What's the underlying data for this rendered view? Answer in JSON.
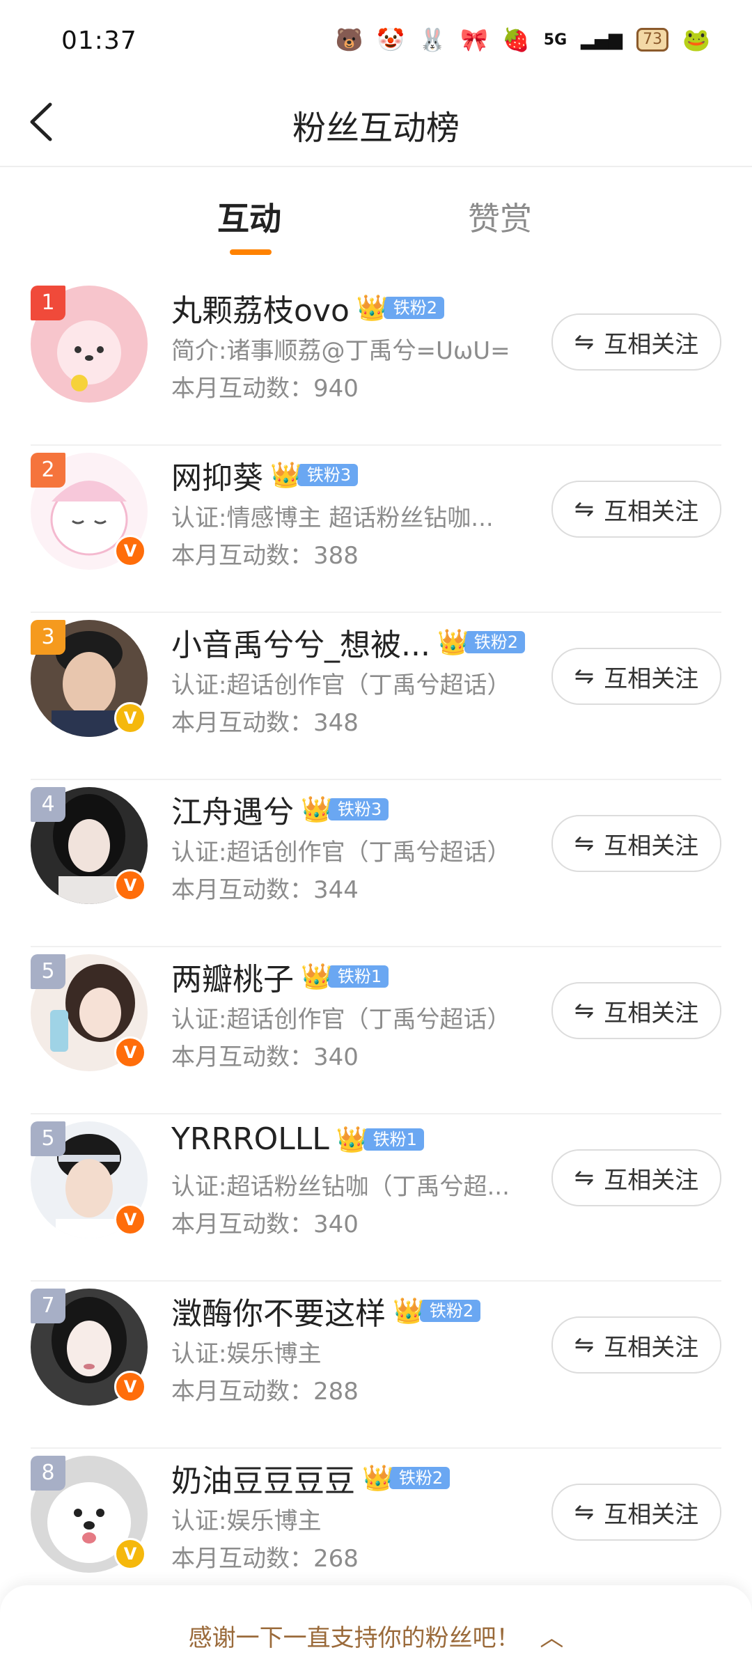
{
  "status_bar": {
    "time": "01:37",
    "network": "5G",
    "battery": "73"
  },
  "header": {
    "title": "粉丝互动榜"
  },
  "tabs": [
    {
      "label": "互动",
      "active": true
    },
    {
      "label": "赞赏",
      "active": false
    }
  ],
  "follow_label": "互相关注",
  "rows": [
    {
      "rank": "1",
      "name": "丸颗荔枝ovo",
      "fan_level": "铁粉2",
      "desc": "简介:诸事顺荔@丁禹兮=ᑌωᑌ=",
      "count": "本月互动数：940"
    },
    {
      "rank": "2",
      "name": "网抑葵",
      "fan_level": "铁粉3",
      "desc": "认证:情感博主 超话粉丝钻咖...",
      "count": "本月互动数：388"
    },
    {
      "rank": "3",
      "name": "小音禹兮兮_想被...",
      "fan_level": "铁粉2",
      "desc": "认证:超话创作官（丁禹兮超话）",
      "count": "本月互动数：348"
    },
    {
      "rank": "4",
      "name": "江舟遇兮",
      "fan_level": "铁粉3",
      "desc": "认证:超话创作官（丁禹兮超话）",
      "count": "本月互动数：344"
    },
    {
      "rank": "5",
      "name": "两瓣桃子",
      "fan_level": "铁粉1",
      "desc": "认证:超话创作官（丁禹兮超话）",
      "count": "本月互动数：340"
    },
    {
      "rank": "5",
      "name": "YRRROLLL",
      "fan_level": "铁粉1",
      "desc": "认证:超话粉丝钻咖（丁禹兮超...",
      "count": "本月互动数：340"
    },
    {
      "rank": "7",
      "name": "澂酶你不要这样",
      "fan_level": "铁粉2",
      "desc": "认证:娱乐博主",
      "count": "本月互动数：288"
    },
    {
      "rank": "8",
      "name": "奶油豆豆豆豆",
      "fan_level": "铁粉2",
      "desc": "认证:娱乐博主",
      "count": "本月互动数：268"
    }
  ],
  "bottom_bar": {
    "text": "感谢一下一直支持你的粉丝吧！"
  },
  "colors": {
    "accent": "#ff8200",
    "rank1": "#f04a3a",
    "rank2": "#f5743c",
    "rank3": "#f59a1e",
    "rank_other": "#a7afc6",
    "fan_badge": "#6aa7f2",
    "verify_orange": "#ff6d0a",
    "verify_yellow": "#f5b80c"
  }
}
